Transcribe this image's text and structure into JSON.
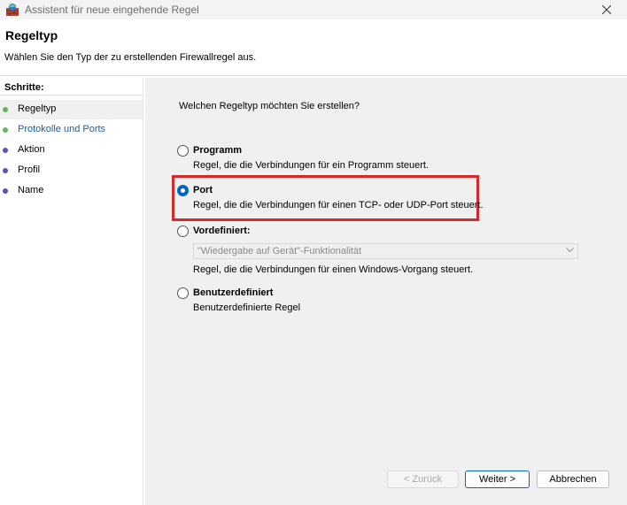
{
  "window": {
    "title": "Assistent für neue eingehende Regel"
  },
  "header": {
    "title": "Regeltyp",
    "description": "Wählen Sie den Typ der zu erstellenden Firewallregel aus."
  },
  "steps": {
    "heading": "Schritte:",
    "items": [
      {
        "label": "Regeltyp",
        "dot_color": "#5cb85c",
        "selected": true
      },
      {
        "label": "Protokolle und Ports",
        "dot_color": "#5cb85c",
        "selected": false
      },
      {
        "label": "Aktion",
        "dot_color": "#5b4fc2",
        "selected": false
      },
      {
        "label": "Profil",
        "dot_color": "#5b4fc2",
        "selected": false
      },
      {
        "label": "Name",
        "dot_color": "#5b4fc2",
        "selected": false
      }
    ]
  },
  "main": {
    "question": "Welchen Regeltyp möchten Sie erstellen?",
    "options": [
      {
        "title": "Programm",
        "desc": "Regel, die die Verbindungen für ein Programm steuert.",
        "checked": false
      },
      {
        "title": "Port",
        "desc": "Regel, die die Verbindungen für einen TCP- oder UDP-Port steuert.",
        "checked": true
      },
      {
        "title": "Vordefiniert:",
        "checked": false
      },
      {
        "title": "Benutzerdefiniert",
        "desc": "Benutzerdefinierte Regel",
        "checked": false
      }
    ],
    "predefined_select_value": "\"Wiedergabe auf Gerät\"-Funktionalität",
    "predefined_desc": "Regel, die die Verbindungen für einen Windows-Vorgang steuert."
  },
  "buttons": {
    "back": "< Zurück",
    "next": "Weiter >",
    "cancel": "Abbrechen"
  },
  "colors": {
    "accent": "#0067c0",
    "highlight": "#d42a2a"
  }
}
